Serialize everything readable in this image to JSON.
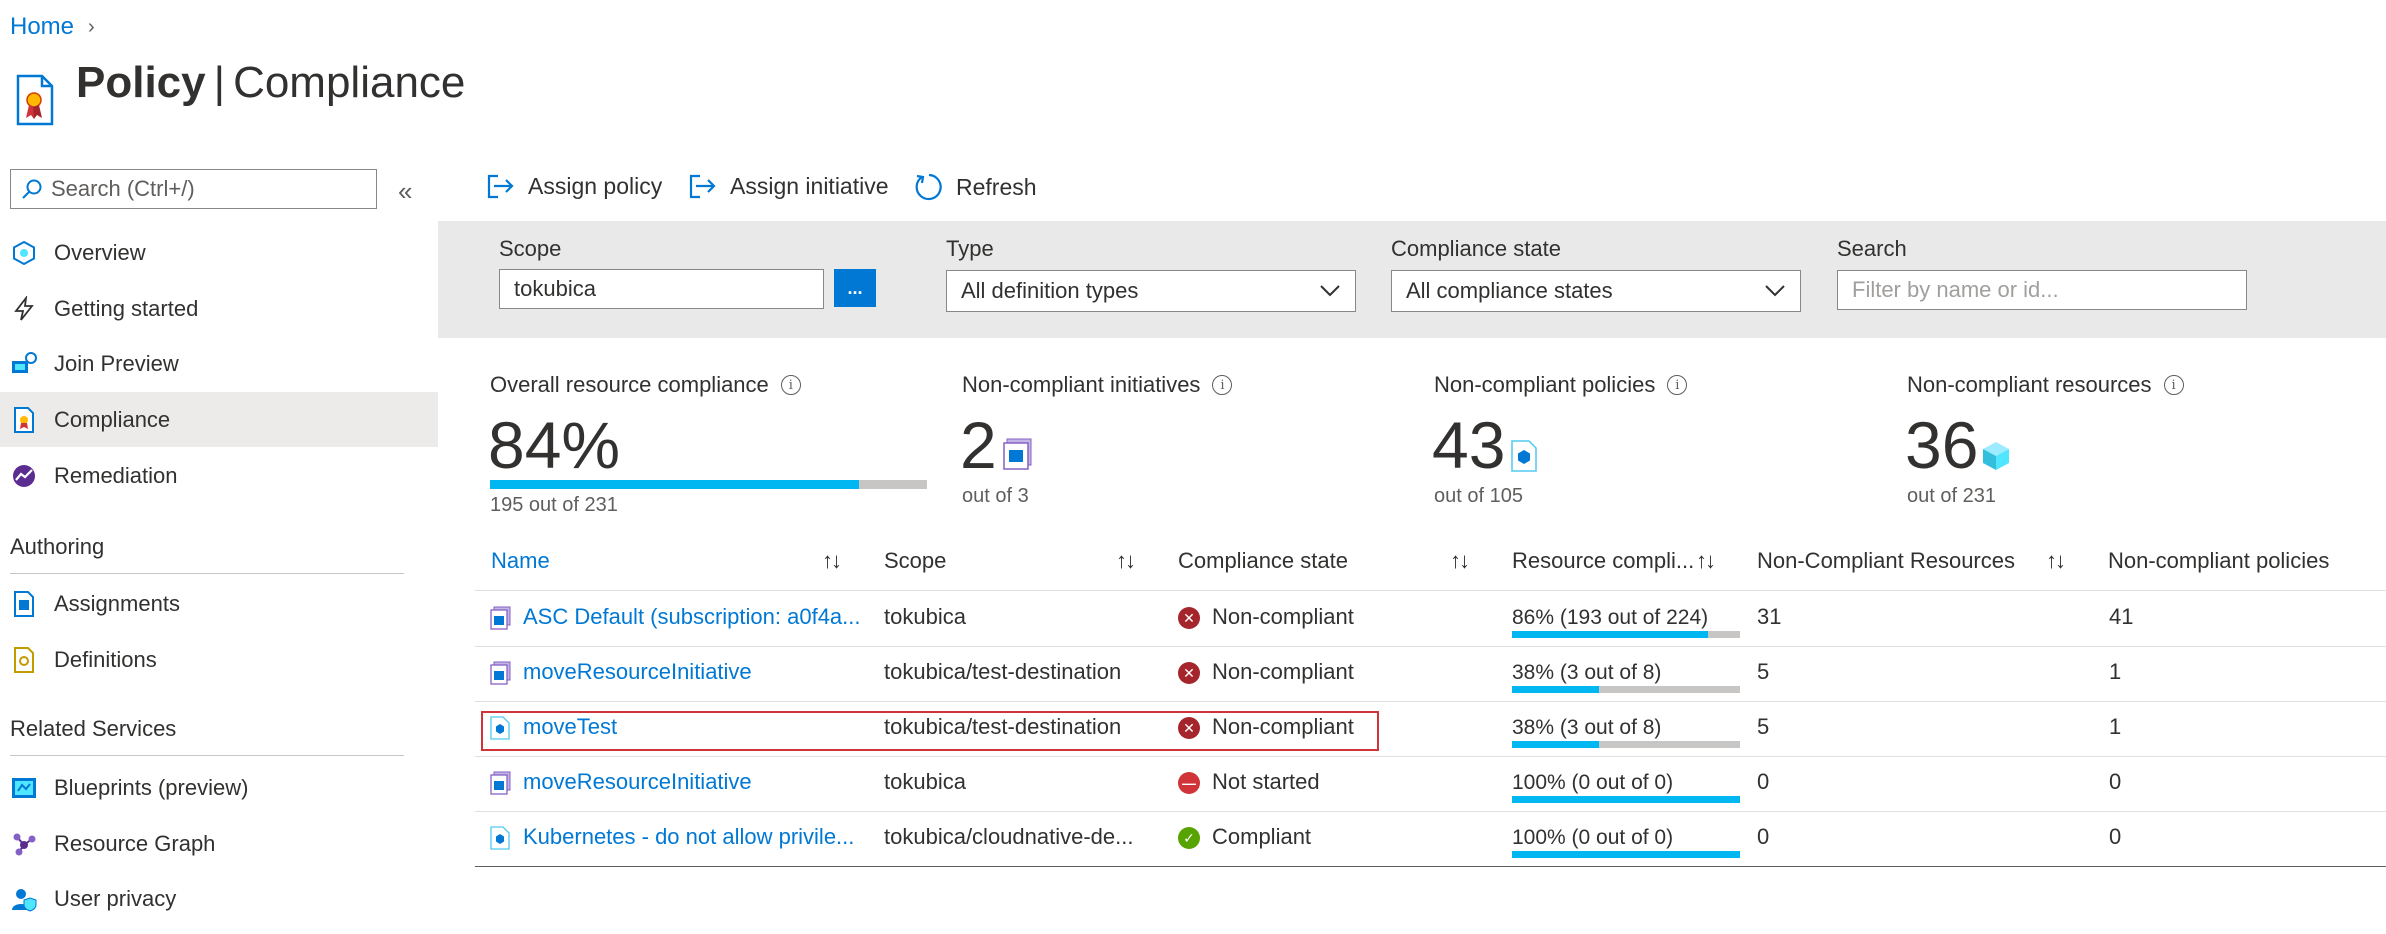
{
  "breadcrumb": {
    "home": "Home"
  },
  "title": {
    "strong": "Policy",
    "sep": "|",
    "rest": "Compliance"
  },
  "search": {
    "placeholder": "Search (Ctrl+/)"
  },
  "nav": {
    "overview": "Overview",
    "getting_started": "Getting started",
    "join_preview": "Join Preview",
    "compliance": "Compliance",
    "remediation": "Remediation",
    "authoring": "Authoring",
    "assignments": "Assignments",
    "definitions": "Definitions",
    "related": "Related Services",
    "blueprints": "Blueprints (preview)",
    "resource_graph": "Resource Graph",
    "user_privacy": "User privacy"
  },
  "toolbar": {
    "assign_policy": "Assign policy",
    "assign_initiative": "Assign initiative",
    "refresh": "Refresh"
  },
  "filters": {
    "scope_label": "Scope",
    "scope_value": "tokubica",
    "scope_btn": "...",
    "type_label": "Type",
    "type_value": "All definition types",
    "state_label": "Compliance state",
    "state_value": "All compliance states",
    "search_label": "Search",
    "search_placeholder": "Filter by name or id..."
  },
  "summary": {
    "overall": {
      "label": "Overall resource compliance",
      "value": "84%",
      "sub": "195 out of 231",
      "fraction": 0.844
    },
    "initiatives": {
      "label": "Non-compliant initiatives",
      "value": "2",
      "sub": "out of 3"
    },
    "policies": {
      "label": "Non-compliant policies",
      "value": "43",
      "sub": "out of 105"
    },
    "resources": {
      "label": "Non-compliant resources",
      "value": "36",
      "sub": "out of 231"
    }
  },
  "table": {
    "headers": [
      "Name",
      "Scope",
      "Compliance state",
      "Resource compli...",
      "Non-Compliant Resources",
      "Non-compliant policies"
    ],
    "rows": [
      {
        "name": "ASC Default (subscription: a0f4a...",
        "icon": "initiative-icon",
        "scope": "tokubica",
        "state": "Non-compliant",
        "state_icon": "error-icon",
        "compliance": "86% (193 out of 224)",
        "fraction": 0.86,
        "ncr": "31",
        "ncp": "41"
      },
      {
        "name": "moveResourceInitiative",
        "icon": "initiative-icon",
        "scope": "tokubica/test-destination",
        "state": "Non-compliant",
        "state_icon": "error-icon",
        "compliance": "38% (3 out of 8)",
        "fraction": 0.38,
        "ncr": "5",
        "ncp": "1"
      },
      {
        "name": "moveTest",
        "icon": "policy-icon",
        "scope": "tokubica/test-destination",
        "state": "Non-compliant",
        "state_icon": "error-icon",
        "compliance": "38% (3 out of 8)",
        "fraction": 0.38,
        "ncr": "5",
        "ncp": "1"
      },
      {
        "name": "moveResourceInitiative",
        "icon": "initiative-icon",
        "scope": "tokubica",
        "state": "Not started",
        "state_icon": "blocked-icon",
        "compliance": "100% (0 out of 0)",
        "fraction": 1.0,
        "ncr": "0",
        "ncp": "0"
      },
      {
        "name": "Kubernetes - do not allow privile...",
        "icon": "policy-icon",
        "scope": "tokubica/cloudnative-de...",
        "state": "Compliant",
        "state_icon": "check-icon",
        "compliance": "100% (0 out of 0)",
        "fraction": 1.0,
        "ncr": "0",
        "ncp": "0"
      }
    ]
  },
  "colors": {
    "accent": "#0078d4",
    "progress": "#00b7f1",
    "error": "#a4262c",
    "blocked": "#d13438",
    "success": "#57a300",
    "highlight": "#d13438"
  }
}
